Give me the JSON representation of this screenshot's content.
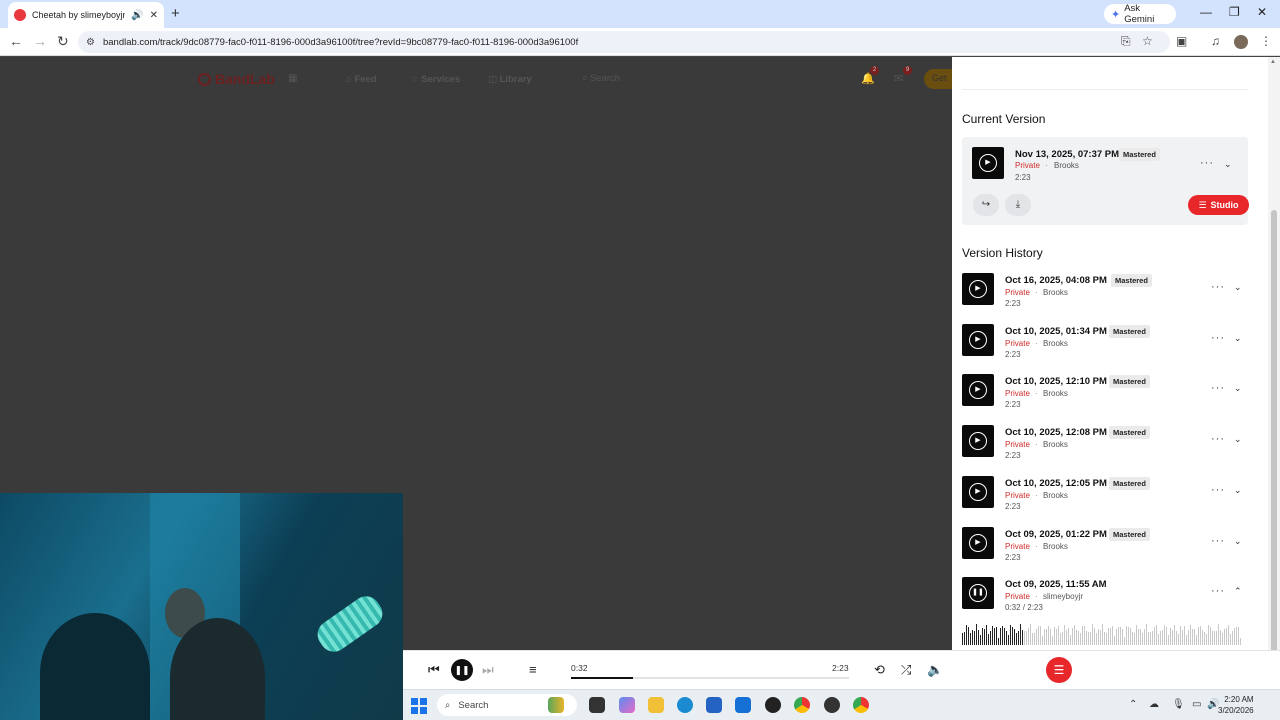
{
  "browser": {
    "tab_title": "Cheetah by slimeyboyjr | Ba",
    "new_tab": "+",
    "ask_gemini": "Ask Gemini",
    "url": "bandlab.com/track/9dc08779-fac0-f011-8196-000d3a96100f/tree?revId=9bc08779-fac0-f011-8196-000d3a96100f"
  },
  "bandlab": {
    "logo": "BandLab",
    "nav": {
      "feed": "Feed",
      "services": "Services",
      "library": "Library"
    },
    "search_placeholder": "Search",
    "notif_count": "2",
    "msg_count": "9",
    "get": "Get"
  },
  "current": {
    "heading": "Current Version",
    "date": "Nov 13, 2025, 07:37 PM",
    "badge": "Mastered",
    "privacy": "Private",
    "owner": "Brooks",
    "duration": "2:23",
    "studio_label": "Studio"
  },
  "history": {
    "heading": "Version History",
    "rows": [
      {
        "date": "Oct 16, 2025, 04:08 PM",
        "badge": "Mastered",
        "privacy": "Private",
        "owner": "Brooks",
        "duration": "2:23"
      },
      {
        "date": "Oct 10, 2025, 01:34 PM",
        "badge": "Mastered",
        "privacy": "Private",
        "owner": "Brooks",
        "duration": "2:23"
      },
      {
        "date": "Oct 10, 2025, 12:10 PM",
        "badge": "Mastered",
        "privacy": "Private",
        "owner": "Brooks",
        "duration": "2:23"
      },
      {
        "date": "Oct 10, 2025, 12:08 PM",
        "badge": "Mastered",
        "privacy": "Private",
        "owner": "Brooks",
        "duration": "2:23"
      },
      {
        "date": "Oct 10, 2025, 12:05 PM",
        "badge": "Mastered",
        "privacy": "Private",
        "owner": "Brooks",
        "duration": "2:23"
      },
      {
        "date": "Oct 09, 2025, 01:22 PM",
        "badge": "Mastered",
        "privacy": "Private",
        "owner": "Brooks",
        "duration": "2:23"
      },
      {
        "date": "Oct 09, 2025, 11:55 AM",
        "badge": "",
        "privacy": "Private",
        "owner": "slimeyboyjr",
        "duration": "0:32 /  2:23"
      }
    ]
  },
  "player": {
    "elapsed": "0:32",
    "total": "2:23",
    "progress_fraction": 0.224
  },
  "taskbar": {
    "search": "Search",
    "time": "2:20 AM",
    "date": "3/20/2026"
  },
  "colors": {
    "accent": "#e8272b",
    "private": "#d22b2b"
  }
}
